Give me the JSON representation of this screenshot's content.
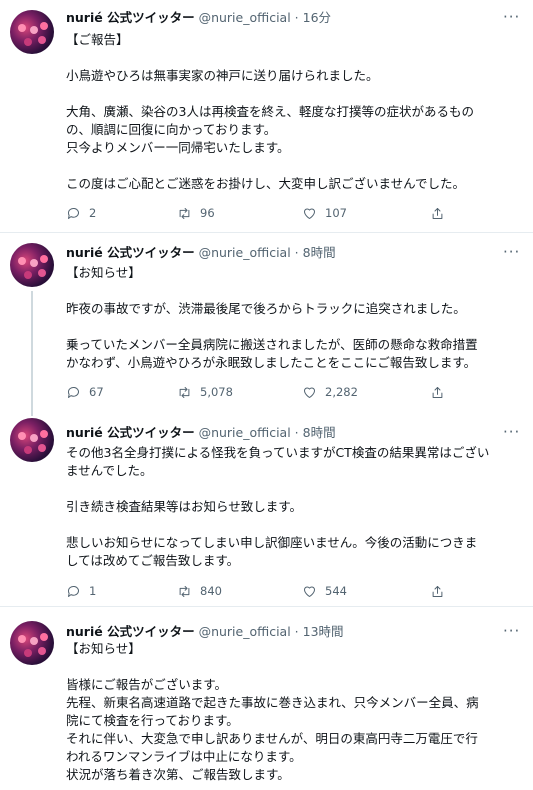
{
  "tweets": [
    {
      "name": "nurié 公式ツイッター",
      "handle": "@nurie_official",
      "separator": "·",
      "time": "16分",
      "lines": [
        "【ご報告】",
        "",
        "小鳥遊やひろは無事実家の神戸に送り届けられました。",
        "",
        "大角、廣瀬、染谷の3人は再検査を終え、軽度な打撲等の症状があるもの",
        "の、順調に回復に向かっております。",
        "只今よりメンバー一同帰宅いたします。",
        "",
        "この度はご心配とご迷惑をお掛けし、大変申し訳ございませんでした。"
      ],
      "replies": "2",
      "retweets": "96",
      "likes": "107"
    },
    {
      "name": "nurié 公式ツイッター",
      "handle": "@nurie_official",
      "separator": "·",
      "time": "8時間",
      "lines": [
        "【お知らせ】",
        "",
        "昨夜の事故ですが、渋滞最後尾で後ろからトラックに追突されました。",
        "",
        "乗っていたメンバー全員病院に搬送されましたが、医師の懸命な救命措置",
        "かなわず、小鳥遊やひろが永眠致しましたことをここにご報告致します。"
      ],
      "replies": "67",
      "retweets": "5,078",
      "likes": "2,282"
    },
    {
      "name": "nurié 公式ツイッター",
      "handle": "@nurie_official",
      "separator": "·",
      "time": "8時間",
      "lines": [
        "その他3名全身打撲による怪我を負っていますがCT検査の結果異常はござい",
        "ませんでした。",
        "",
        "引き続き検査結果等はお知らせ致します。",
        "",
        "悲しいお知らせになってしまい申し訳御座いません。今後の活動につきま",
        "しては改めてご報告致します。"
      ],
      "replies": "1",
      "retweets": "840",
      "likes": "544"
    },
    {
      "name": "nurié 公式ツイッター",
      "handle": "@nurie_official",
      "separator": "·",
      "time": "13時間",
      "lines": [
        "【お知らせ】",
        "",
        "皆様にご報告がございます。",
        "先程、新東名高速道路で起きた事故に巻き込まれ、只今メンバー全員、病",
        "院にて検査を行っております。",
        "それに伴い、大変急で申し訳ありませんが、明日の東高円寺二万電圧で行",
        "われるワンマンライブは中止になります。",
        "状況が落ち着き次第、ご報告致します。"
      ]
    }
  ],
  "icons": {
    "reply": "reply-icon",
    "retweet": "retweet-icon",
    "like": "like-icon",
    "share": "share-icon",
    "more": "more-icon"
  }
}
